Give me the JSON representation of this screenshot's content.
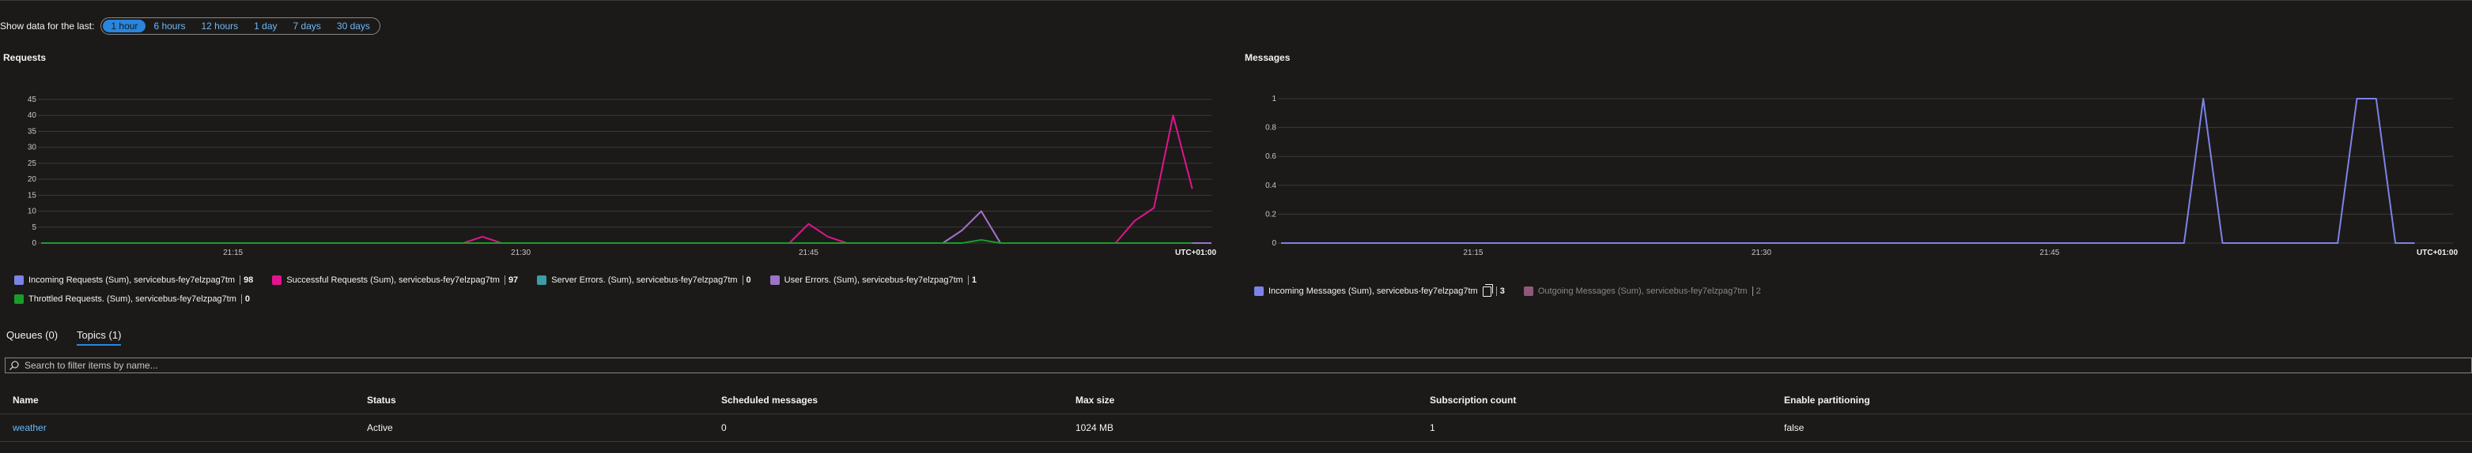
{
  "time_range": {
    "label": "Show data for the last:",
    "options": [
      "1 hour",
      "6 hours",
      "12 hours",
      "1 day",
      "7 days",
      "30 days"
    ],
    "selected": "1 hour"
  },
  "requests_chart": {
    "title": "Requests",
    "timezone": "UTC+01:00",
    "legend": [
      {
        "label": "Incoming Requests (Sum), servicebus-fey7elzpag7tm",
        "value": "98",
        "color": "#7c83e6"
      },
      {
        "label": "Successful Requests (Sum), servicebus-fey7elzpag7tm",
        "value": "97",
        "color": "#e3138d"
      },
      {
        "label": "Server Errors. (Sum), servicebus-fey7elzpag7tm",
        "value": "0",
        "color": "#3a9ea6"
      },
      {
        "label": "User Errors. (Sum), servicebus-fey7elzpag7tm",
        "value": "1",
        "color": "#9a74c7"
      },
      {
        "label": "Throttled Requests. (Sum), servicebus-fey7elzpag7tm",
        "value": "0",
        "color": "#1a9c2a"
      }
    ]
  },
  "messages_chart": {
    "title": "Messages",
    "timezone": "UTC+01:00",
    "legend": [
      {
        "label": "Incoming Messages (Sum), servicebus-fey7elzpag7tm",
        "value": "3",
        "color": "#7c83e6",
        "icon": "copy-icon"
      },
      {
        "label": "Outgoing Messages (Sum), servicebus-fey7elzpag7tm",
        "value": "2",
        "color": "#8e5a7a",
        "muted": true
      }
    ]
  },
  "chart_data": [
    {
      "type": "line",
      "title": "Requests",
      "x_ticks": [
        "21:15",
        "21:30",
        "21:45"
      ],
      "ylim": [
        0,
        45
      ],
      "y_ticks": [
        0,
        5,
        10,
        15,
        20,
        25,
        30,
        35,
        40,
        45
      ],
      "x_range_minutes": [
        0,
        61
      ],
      "tick_positions_minutes": [
        10,
        25,
        40
      ],
      "series": [
        {
          "name": "Successful Requests (Sum), servicebus-fey7elzpag7tm",
          "color": "#e3138d",
          "points": [
            [
              0,
              0
            ],
            [
              22,
              0
            ],
            [
              23,
              2
            ],
            [
              24,
              0
            ],
            [
              39,
              0
            ],
            [
              40,
              6
            ],
            [
              41,
              2
            ],
            [
              42,
              0
            ],
            [
              47,
              0
            ],
            [
              48,
              4
            ],
            [
              49,
              10
            ],
            [
              50,
              0
            ],
            [
              56,
              0
            ],
            [
              57,
              7
            ],
            [
              58,
              11
            ],
            [
              59,
              40
            ],
            [
              60,
              17
            ]
          ]
        },
        {
          "name": "Incoming Requests (Sum), servicebus-fey7elzpag7tm",
          "color": "#9a74c7",
          "points": [
            [
              0,
              0
            ],
            [
              47,
              0
            ],
            [
              48,
              4
            ],
            [
              49,
              10
            ],
            [
              50,
              0
            ],
            [
              61,
              0
            ]
          ]
        },
        {
          "name": "Throttled Requests. (Sum), servicebus-fey7elzpag7tm",
          "color": "#1a9c2a",
          "points": [
            [
              0,
              0
            ],
            [
              48,
              0
            ],
            [
              49,
              1
            ],
            [
              50,
              0
            ],
            [
              60,
              0
            ]
          ]
        }
      ]
    },
    {
      "type": "line",
      "title": "Messages",
      "x_ticks": [
        "21:15",
        "21:30",
        "21:45"
      ],
      "ylim": [
        0,
        1
      ],
      "y_ticks": [
        0,
        0.2,
        0.4,
        0.6,
        0.8,
        1
      ],
      "x_range_minutes": [
        0,
        61
      ],
      "tick_positions_minutes": [
        10,
        25,
        40
      ],
      "series": [
        {
          "name": "Incoming Messages (Sum), servicebus-fey7elzpag7tm",
          "color": "#7c83e6",
          "points": [
            [
              0,
              0
            ],
            [
              47,
              0
            ],
            [
              48,
              1
            ],
            [
              49,
              0
            ],
            [
              55,
              0
            ],
            [
              56,
              1
            ],
            [
              57,
              1
            ],
            [
              58,
              0
            ],
            [
              59,
              0
            ]
          ]
        }
      ]
    }
  ],
  "tabs": [
    {
      "label": "Queues (0)",
      "active": false
    },
    {
      "label": "Topics (1)",
      "active": true
    }
  ],
  "search": {
    "placeholder": "Search to filter items by name..."
  },
  "table": {
    "headers": [
      "Name",
      "Status",
      "Scheduled messages",
      "Max size",
      "Subscription count",
      "Enable partitioning"
    ],
    "rows": [
      [
        "weather",
        "Active",
        "0",
        "1024 MB",
        "1",
        "false"
      ]
    ]
  }
}
